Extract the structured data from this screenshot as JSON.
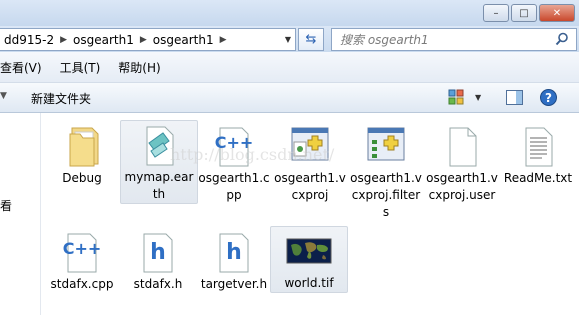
{
  "breadcrumb": [
    "dd915-2",
    "osgearth1",
    "osgearth1"
  ],
  "search_placeholder": "搜索 osgearth1",
  "menu": [
    "查看(V)",
    "工具(T)",
    "帮助(H)"
  ],
  "toolbar": {
    "new_folder": "新建文件夹"
  },
  "nav_label": "看",
  "watermark": "http://blog.csdn.net/",
  "files": [
    {
      "name": "Debug",
      "icon": "folder-icon"
    },
    {
      "name": "mymap.earth",
      "icon": "map-document-icon",
      "selected": true
    },
    {
      "name": "osgearth1.cpp",
      "icon": "cpp-file-icon"
    },
    {
      "name": "osgearth1.vcxproj",
      "icon": "vcxproj-file-icon"
    },
    {
      "name": "osgearth1.vcxproj.filters",
      "icon": "vcxproj-filters-icon"
    },
    {
      "name": "osgearth1.vcxproj.user",
      "icon": "blank-file-icon"
    },
    {
      "name": "ReadMe.txt",
      "icon": "text-file-icon"
    },
    {
      "name": "stdafx.cpp",
      "icon": "cpp-file-icon"
    },
    {
      "name": "stdafx.h",
      "icon": "header-file-icon"
    },
    {
      "name": "targetver.h",
      "icon": "header-file-icon"
    },
    {
      "name": "world.tif",
      "icon": "image-thumbnail-icon",
      "selected": true
    }
  ]
}
